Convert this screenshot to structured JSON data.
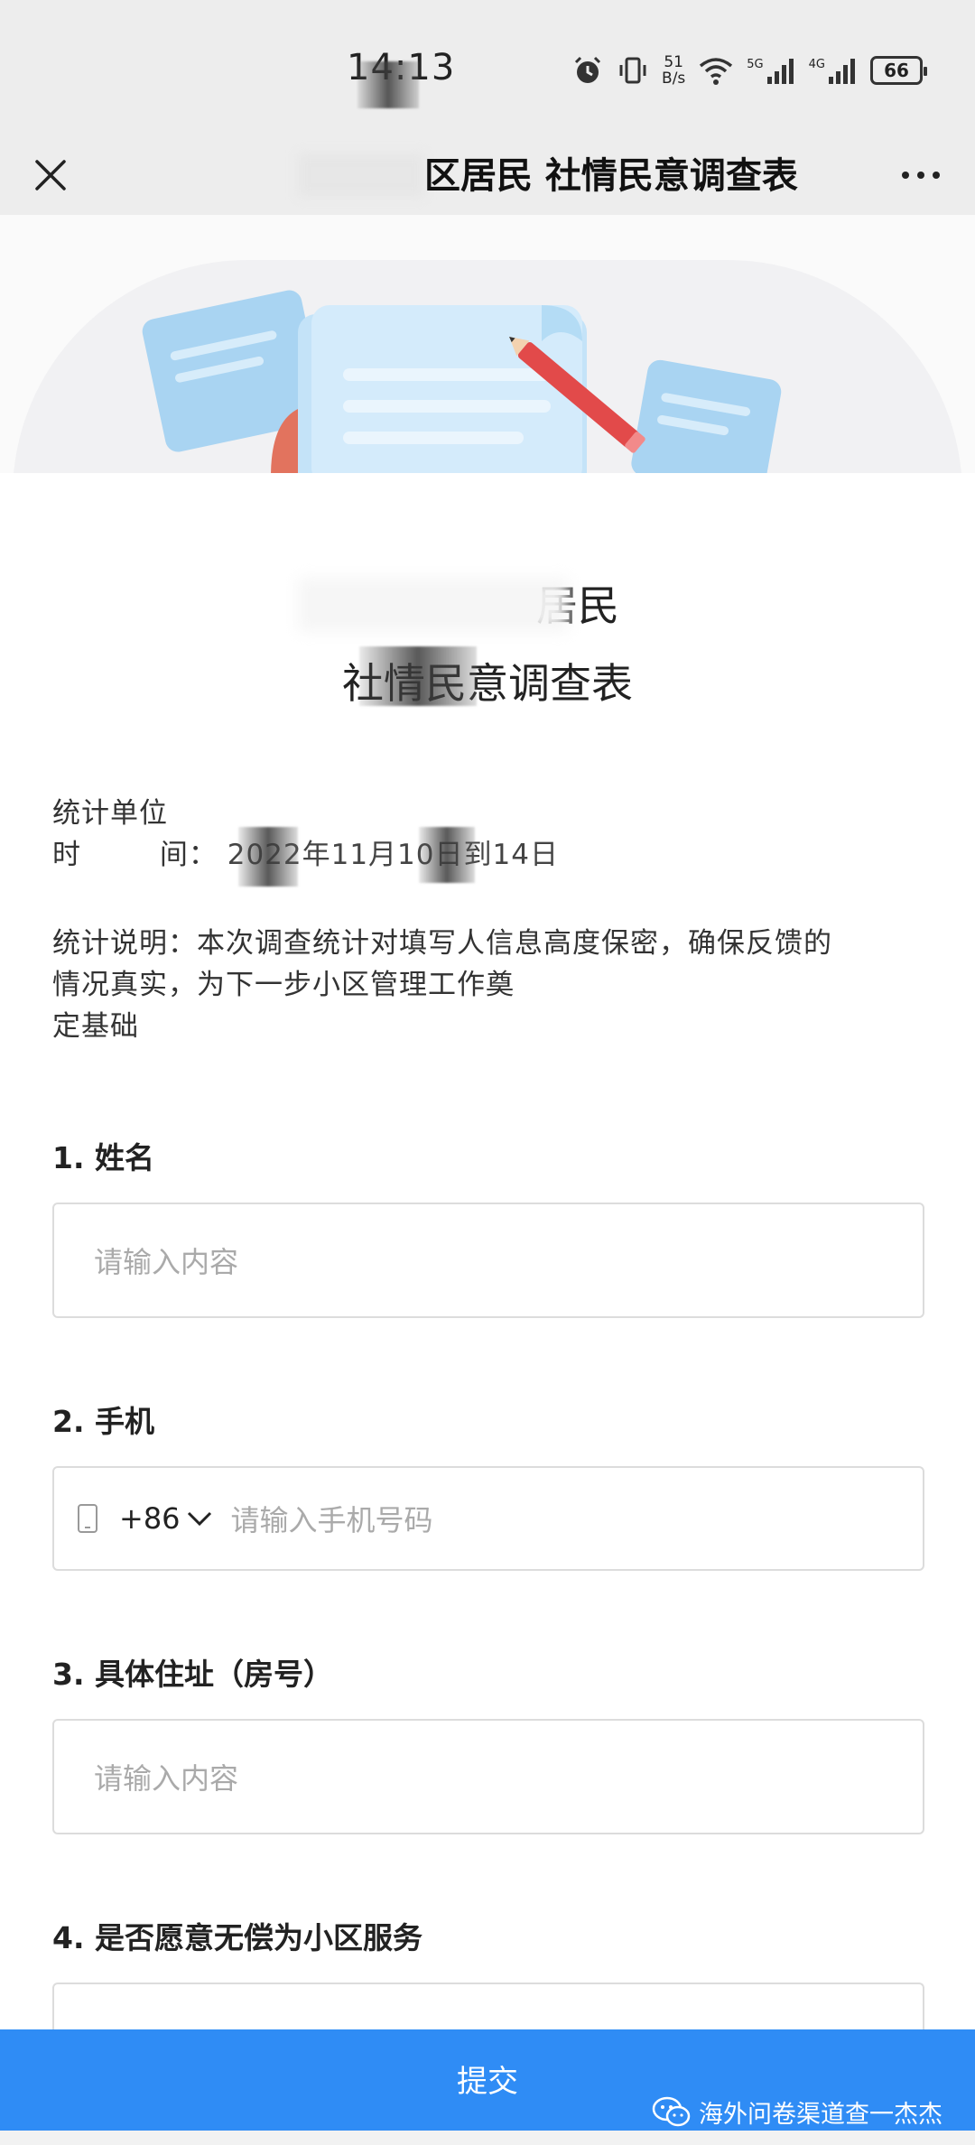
{
  "status_bar": {
    "time": "14:13",
    "net_speed_value": "51",
    "net_speed_unit": "B/s",
    "sim1": "5G",
    "sim2": "4G",
    "battery": "66"
  },
  "nav": {
    "title": "区居民 社情民意调查表"
  },
  "banner": {
    "illustration": "document-with-pencil"
  },
  "survey": {
    "title_line1": "居民",
    "title_line2": "社情民意调查表",
    "unit_label": "统计单位",
    "time_label_a": "时",
    "time_label_b": "间：",
    "time_value": "2022年11月10日到14日",
    "desc_line1": "统计说明：本次调查统计对填写人信息高度保密，确保反馈的",
    "desc_line2": "情况真实，为下一步小区管理工作奠",
    "desc_line3": "定基础"
  },
  "questions": [
    {
      "label": "1. 姓名",
      "placeholder": "请输入内容"
    },
    {
      "label": "2. 手机",
      "country_code": "+86",
      "placeholder": "请输入手机号码"
    },
    {
      "label": "3. 具体住址（房号）",
      "placeholder": "请输入内容"
    },
    {
      "label": "4. 是否愿意无偿为小区服务"
    }
  ],
  "submit": {
    "label": "提交"
  },
  "watermark": {
    "text": "海外问卷渠道查一杰杰"
  },
  "colors": {
    "primary": "#2f8cf5",
    "header_bg": "#ededed",
    "border": "#dcdcdc",
    "placeholder": "#aaaaaa"
  }
}
